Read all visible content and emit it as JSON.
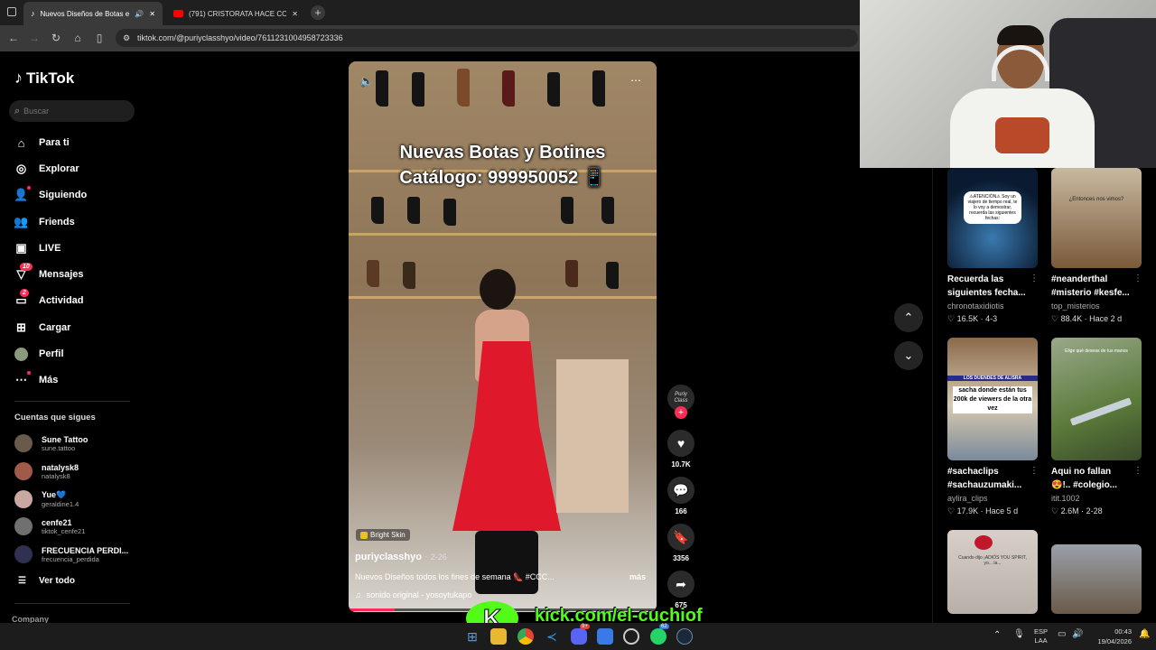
{
  "browser": {
    "tabs": [
      {
        "title": "Nuevos Diseños de Botas e...",
        "icon": "tiktok-icon"
      },
      {
        "title": "(791) CRISTORATA HACE COM...",
        "icon": "youtube-icon"
      }
    ],
    "url": "tiktok.com/@puriyclasshyo/video/7611231004958723336"
  },
  "sidebar": {
    "logo": "TikTok",
    "search_placeholder": "Buscar",
    "nav": [
      {
        "label": "Para ti",
        "icon": "home-icon"
      },
      {
        "label": "Explorar",
        "icon": "compass-icon"
      },
      {
        "label": "Siguiendo",
        "icon": "following-icon"
      },
      {
        "label": "Friends",
        "icon": "friends-icon"
      },
      {
        "label": "LIVE",
        "icon": "live-icon"
      },
      {
        "label": "Mensajes",
        "icon": "messages-icon",
        "badge": "10"
      },
      {
        "label": "Actividad",
        "icon": "activity-icon",
        "badge": "2"
      },
      {
        "label": "Cargar",
        "icon": "upload-icon"
      },
      {
        "label": "Perfil",
        "icon": "profile-icon"
      },
      {
        "label": "Más",
        "icon": "more-icon"
      }
    ],
    "following_title": "Cuentas que sigues",
    "following": [
      {
        "name": "Sune Tattoo",
        "handle": "sune.tattoo",
        "color": "#6a5a4a"
      },
      {
        "name": "natalysk8",
        "handle": "natalysk8",
        "color": "#a05a4a"
      },
      {
        "name": "Yue💙",
        "handle": "geraldine1.4",
        "color": "#c8a8a0"
      },
      {
        "name": "cenfe21",
        "handle": "tiktok_cenfe21",
        "color": "#707070"
      },
      {
        "name": "FRECUENCIA PERDI...",
        "handle": "frecuencia_perdida",
        "color": "#303050"
      }
    ],
    "see_all": "Ver todo",
    "footer": "Company"
  },
  "video": {
    "overlay_line1": "Nuevas Botas y Botines",
    "overlay_line2": "Catálogo: 999950052 📱",
    "effect_tag": "Bright Skin",
    "author": "puriyclasshyo",
    "date": "2-26",
    "description": "Nuevos Diseños todos los fines de semana 👠 #CCC...",
    "more": "más",
    "sound": "sonido original - yosoytukapo",
    "likes": "10.7K",
    "comments": "166",
    "saves": "3356",
    "shares": "675",
    "avatar_text": "Puriy Class"
  },
  "stream_overlay": {
    "kick_text": "kick.com/el-cuchiof"
  },
  "recommendations": [
    {
      "caption_l1": "Recuerda las",
      "caption_l2": "siguientes fecha...",
      "author": "chronotaxidiotis",
      "views": "16.5K",
      "date": "4-3",
      "thumb_text": "⚠ATENCIÓN⚠ Soy un viajero de tiempo real, te lo voy a demostrar, recuerda las siguientes fechas:"
    },
    {
      "caption_l1": "#neanderthal",
      "caption_l2": "#misterio #kesfe...",
      "author": "top_misterios",
      "views": "88.4K",
      "date": "Hace 2 d",
      "thumb_text": "¿Entonces nos vimos?"
    },
    {
      "caption_l1": "#sachaclips",
      "caption_l2": "#sachauzumaki...",
      "author": "aylira_clips",
      "views": "17.9K",
      "date": "Hace 5 d",
      "thumb_text_top": "LOS DUENDES DE ALISRA",
      "thumb_text": "sacha donde están tus 200k de viewers de la otra vez"
    },
    {
      "caption_l1": "Aqui no fallan",
      "caption_l2": "😍!.. #colegio...",
      "author": "itit.1002",
      "views": "2.6M",
      "date": "2-28",
      "thumb_text": "Elige qué deseas de tus manos"
    },
    {
      "thumb_text": "Cuando dijo ¡ADIÓS YOU SPIRIT, yo... la..."
    },
    {
      "thumb_text": ""
    }
  ],
  "taskbar": {
    "lang1": "ESP",
    "lang2": "LAA",
    "time": "00:43",
    "date": "19/04/2026",
    "discord_badge": "9+",
    "whatsapp_badge": "62"
  }
}
